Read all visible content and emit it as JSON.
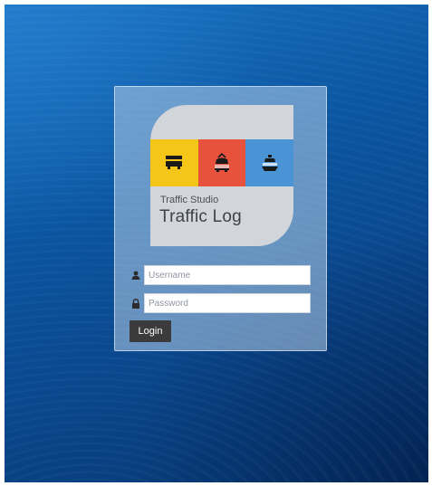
{
  "logo": {
    "subtitle": "Traffic Studio",
    "title": "Traffic Log",
    "tiles": [
      {
        "icon": "bus-icon",
        "color": "#f5c518"
      },
      {
        "icon": "tram-icon",
        "color": "#e8523d"
      },
      {
        "icon": "ferry-icon",
        "color": "#4a93d4"
      }
    ]
  },
  "form": {
    "username_placeholder": "Username",
    "password_placeholder": "Password",
    "login_label": "Login"
  },
  "colors": {
    "background": "#0b57a3",
    "button": "#3b3b3b"
  }
}
